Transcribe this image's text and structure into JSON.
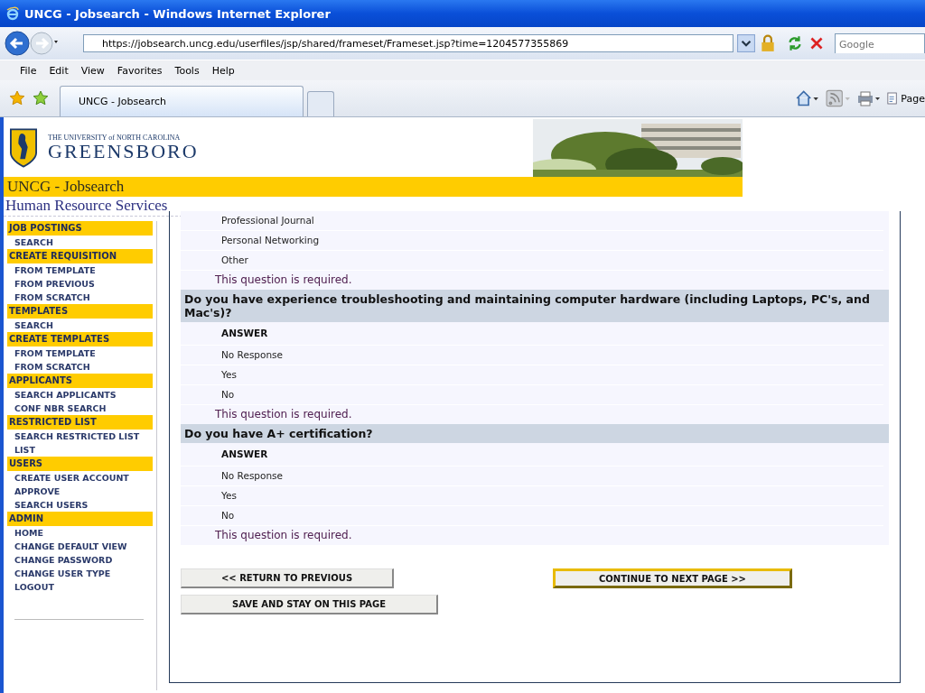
{
  "window": {
    "title": "UNCG - Jobsearch - Windows Internet Explorer"
  },
  "address_bar": {
    "url": "https://jobsearch.uncg.edu/userfiles/jsp/shared/frameset/Frameset.jsp?time=1204577355869"
  },
  "search": {
    "placeholder": "Google"
  },
  "menu": [
    "File",
    "Edit",
    "View",
    "Favorites",
    "Tools",
    "Help"
  ],
  "tabs": [
    {
      "label": "UNCG - Jobsearch",
      "selected": true
    },
    {
      "selected": false
    }
  ],
  "toolbar": {
    "page_label": "Page"
  },
  "header": {
    "university_line": "THE UNIVERSITY of NORTH CAROLINA",
    "university_name": "GREENSBORO",
    "site_title": "UNCG - Jobsearch",
    "department": "Human Resource Services"
  },
  "sidebar": [
    {
      "heading": "JOB POSTINGS",
      "items": [
        "SEARCH"
      ]
    },
    {
      "heading": "CREATE REQUISITION",
      "items": [
        "FROM TEMPLATE",
        "FROM PREVIOUS",
        "FROM SCRATCH"
      ]
    },
    {
      "heading": "TEMPLATES",
      "items": [
        "SEARCH"
      ]
    },
    {
      "heading": "CREATE TEMPLATES",
      "items": [
        "FROM TEMPLATE",
        "FROM SCRATCH"
      ]
    },
    {
      "heading": "APPLICANTS",
      "items": [
        "SEARCH APPLICANTS",
        "CONF NBR SEARCH"
      ]
    },
    {
      "heading": "RESTRICTED LIST",
      "items": [
        "SEARCH RESTRICTED LIST LIST"
      ]
    },
    {
      "heading": "USERS",
      "items": [
        "CREATE USER ACCOUNT",
        "APPROVE",
        "SEARCH USERS"
      ]
    },
    {
      "heading": "ADMIN",
      "items": [
        "HOME",
        "CHANGE DEFAULT VIEW",
        "CHANGE PASSWORD",
        "CHANGE USER TYPE",
        "LOGOUT"
      ]
    }
  ],
  "questions": [
    {
      "options": [
        "Professional Journal",
        "Personal Networking",
        "Other"
      ],
      "note": "This question is required."
    },
    {
      "question": "Do you have experience troubleshooting and maintaining computer hardware (including Laptops, PC's, and Mac's)?",
      "answer_header": "ANSWER",
      "options": [
        "No Response",
        "Yes",
        "No"
      ],
      "note": "This question is required."
    },
    {
      "question": "Do you have A+ certification?",
      "answer_header": "ANSWER",
      "options": [
        "No Response",
        "Yes",
        "No"
      ],
      "note": "This question is required."
    }
  ],
  "buttons": [
    {
      "label": "<< RETURN TO PREVIOUS",
      "default": false
    },
    {
      "label": "CONTINUE TO NEXT PAGE >>",
      "default": true
    },
    {
      "label": "SAVE AND STAY ON THIS PAGE",
      "default": false
    }
  ]
}
